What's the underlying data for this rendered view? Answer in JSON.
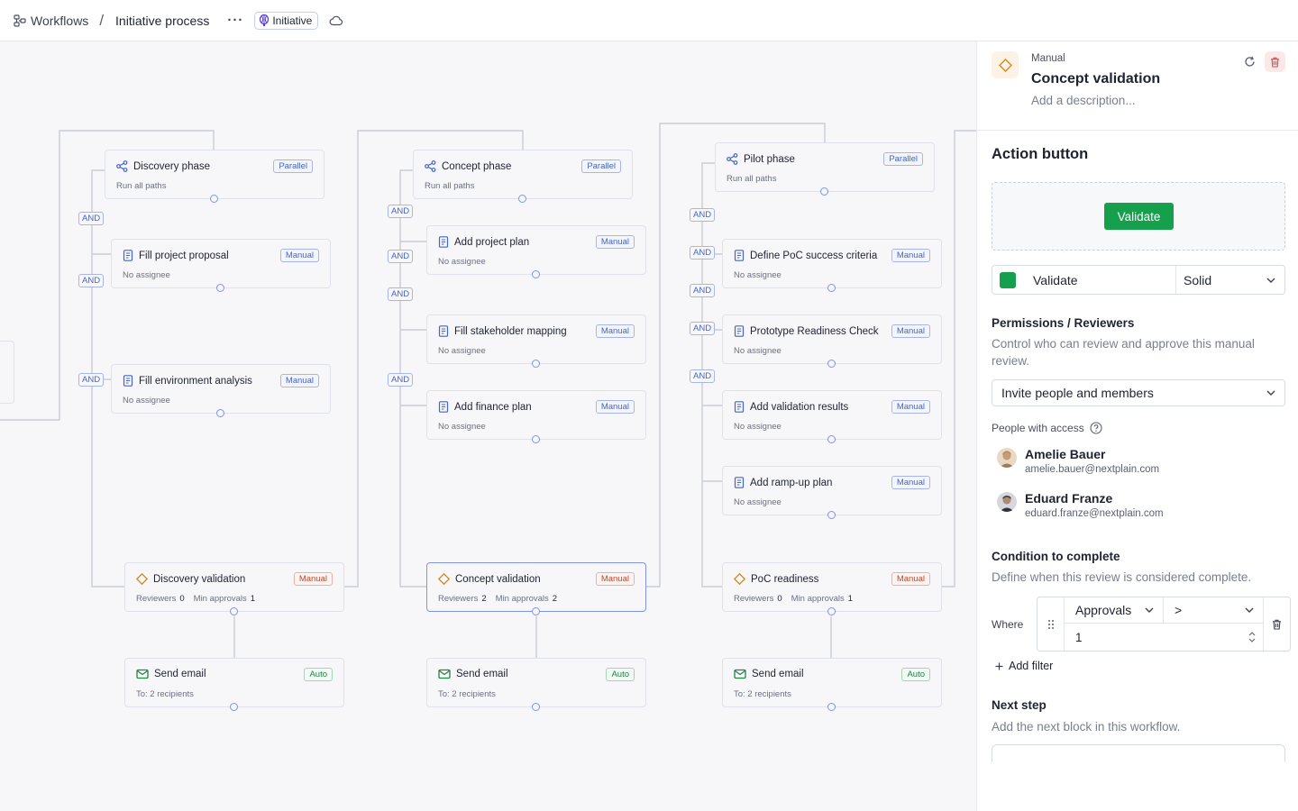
{
  "topbar": {
    "breadcrumb_root": "Workflows",
    "separator": "/",
    "breadcrumb_current": "Initiative process",
    "more": "···",
    "tag": "Initiative"
  },
  "canvas": {
    "and_label": "AND",
    "nodes": [
      {
        "id": "discovery-phase",
        "title": "Discovery phase",
        "sub": "Run all paths",
        "badge": "Parallel",
        "icon": "share-nodes-icon"
      },
      {
        "id": "fill-project-proposal",
        "title": "Fill project proposal",
        "sub": "No assignee",
        "badge": "Manual",
        "icon": "document-icon"
      },
      {
        "id": "fill-environment-analysis",
        "title": "Fill environment analysis",
        "sub": "No assignee",
        "badge": "Manual",
        "icon": "document-icon"
      },
      {
        "id": "discovery-validation",
        "title": "Discovery validation",
        "reviewers_label": "Reviewers",
        "reviewers": "0",
        "min_label": "Min approvals",
        "min": "1",
        "badge": "Manual",
        "icon": "diamond-icon"
      },
      {
        "id": "send-email-1",
        "title": "Send email",
        "sub": "To:  2 recipients",
        "badge": "Auto",
        "icon": "mail-icon"
      },
      {
        "id": "concept-phase",
        "title": "Concept phase",
        "sub": "Run all paths",
        "badge": "Parallel",
        "icon": "share-nodes-icon"
      },
      {
        "id": "add-project-plan",
        "title": "Add project plan",
        "sub": "No assignee",
        "badge": "Manual",
        "icon": "document-icon"
      },
      {
        "id": "fill-stakeholder-mapping",
        "title": "Fill stakeholder mapping",
        "sub": "No assignee",
        "badge": "Manual",
        "icon": "document-icon"
      },
      {
        "id": "add-finance-plan",
        "title": "Add finance plan",
        "sub": "No assignee",
        "badge": "Manual",
        "icon": "document-icon"
      },
      {
        "id": "concept-validation",
        "title": "Concept validation",
        "reviewers_label": "Reviewers",
        "reviewers": "2",
        "min_label": "Min approvals",
        "min": "2",
        "badge": "Manual",
        "icon": "diamond-icon"
      },
      {
        "id": "send-email-2",
        "title": "Send email",
        "sub": "To:  2 recipients",
        "badge": "Auto",
        "icon": "mail-icon"
      },
      {
        "id": "pilot-phase",
        "title": "Pilot phase",
        "sub": "Run all paths",
        "badge": "Parallel",
        "icon": "share-nodes-icon"
      },
      {
        "id": "define-poc-success-criteria",
        "title": "Define PoC success criteria",
        "sub": "No assignee",
        "badge": "Manual",
        "icon": "document-icon"
      },
      {
        "id": "prototype-readiness-check",
        "title": "Prototype Readiness Check",
        "sub": "No assignee",
        "badge": "Manual",
        "icon": "document-icon"
      },
      {
        "id": "add-validation-results",
        "title": "Add validation results",
        "sub": "No assignee",
        "badge": "Manual",
        "icon": "document-icon"
      },
      {
        "id": "add-ramp-up-plan",
        "title": "Add ramp-up plan",
        "sub": "No assignee",
        "badge": "Manual",
        "icon": "document-icon"
      },
      {
        "id": "poc-readiness",
        "title": "PoC readiness",
        "reviewers_label": "Reviewers",
        "reviewers": "0",
        "min_label": "Min approvals",
        "min": "1",
        "badge": "Manual",
        "icon": "diamond-icon"
      },
      {
        "id": "send-email-3",
        "title": "Send email",
        "sub": "To:  2 recipients",
        "badge": "Auto",
        "icon": "mail-icon"
      }
    ]
  },
  "panel": {
    "type": "Manual",
    "title": "Concept validation",
    "description_placeholder": "Add a description...",
    "action_button": {
      "heading": "Action button",
      "preview_label": "Validate",
      "label_value": "Validate",
      "style_value": "Solid",
      "color": "#16a04e"
    },
    "permissions": {
      "heading": "Permissions / Reviewers",
      "description": "Control who can review and approve this manual review.",
      "invite_select": "Invite people and members",
      "people_label": "People with access",
      "people": [
        {
          "name": "Amelie Bauer",
          "email": "amelie.bauer@nextplain.com"
        },
        {
          "name": "Eduard Franze",
          "email": "eduard.franze@nextplain.com"
        }
      ]
    },
    "condition": {
      "heading": "Condition to complete",
      "description": "Define when this review is considered complete.",
      "where_label": "Where",
      "field": "Approvals",
      "operator": ">",
      "value": "1",
      "add_filter": "Add filter"
    },
    "next_step": {
      "heading": "Next step",
      "description": "Add the next block in this workflow."
    }
  }
}
